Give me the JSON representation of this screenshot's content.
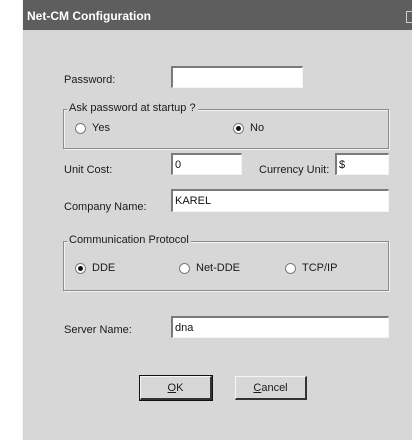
{
  "window": {
    "title": "Net-CM Configuration"
  },
  "password": {
    "label": "Password:",
    "value": ""
  },
  "ask_password": {
    "legend": "Ask password at startup ?",
    "options": [
      {
        "label": "Yes",
        "selected": false
      },
      {
        "label": "No",
        "selected": true
      }
    ]
  },
  "unit_cost": {
    "label": "Unit Cost:",
    "value": "0"
  },
  "currency_unit": {
    "label": "Currency Unit:",
    "value": "$"
  },
  "company_name": {
    "label": "Company Name:",
    "value": "KAREL"
  },
  "protocol": {
    "legend": "Communication Protocol",
    "options": [
      {
        "label": "DDE",
        "selected": true
      },
      {
        "label": "Net-DDE",
        "selected": false
      },
      {
        "label": "TCP/IP",
        "selected": false
      }
    ]
  },
  "server_name": {
    "label": "Server Name:",
    "value": "dna"
  },
  "buttons": {
    "ok": {
      "mnemonic": "O",
      "rest": "K"
    },
    "cancel": {
      "mnemonic": "C",
      "rest": "ancel"
    }
  }
}
